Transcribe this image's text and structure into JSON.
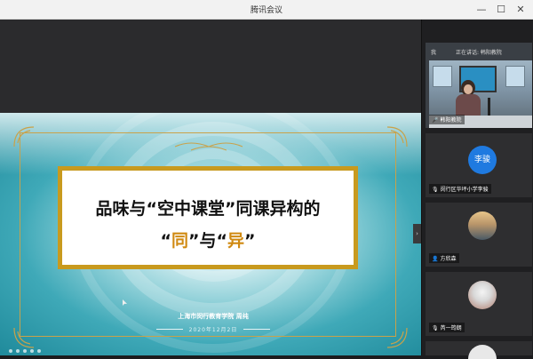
{
  "app": {
    "title": "腾讯会议"
  },
  "window_controls": {
    "minimize": "—",
    "maximize": "☐",
    "close": "✕"
  },
  "slide": {
    "title_line1": "品味与“空中课堂”同课异构的",
    "title_line2_prefix": "“",
    "title_line2_hl1": "同",
    "title_line2_mid": "”与“",
    "title_line2_hl2": "异",
    "title_line2_suffix": "”",
    "institution": "上海市闵行教育学院 周纯",
    "date": "2020年12月2日",
    "accent_color": "#c89a1e"
  },
  "sidebar": {
    "me_label": "我",
    "speaking_label": "正在讲话: 韩阳教院",
    "participants": [
      {
        "name": "韩阳教院",
        "type": "video",
        "mic_icon": "mic-icon"
      },
      {
        "name": "闵行区华坪小学李骏",
        "type": "avatar-initial",
        "initial": "李骏",
        "avatar_color": "#1f7ae0"
      },
      {
        "name": "方欣森",
        "type": "avatar-photo"
      },
      {
        "name": "芮一筠朗",
        "type": "avatar-photo"
      }
    ],
    "collapse_glyph": "›"
  }
}
